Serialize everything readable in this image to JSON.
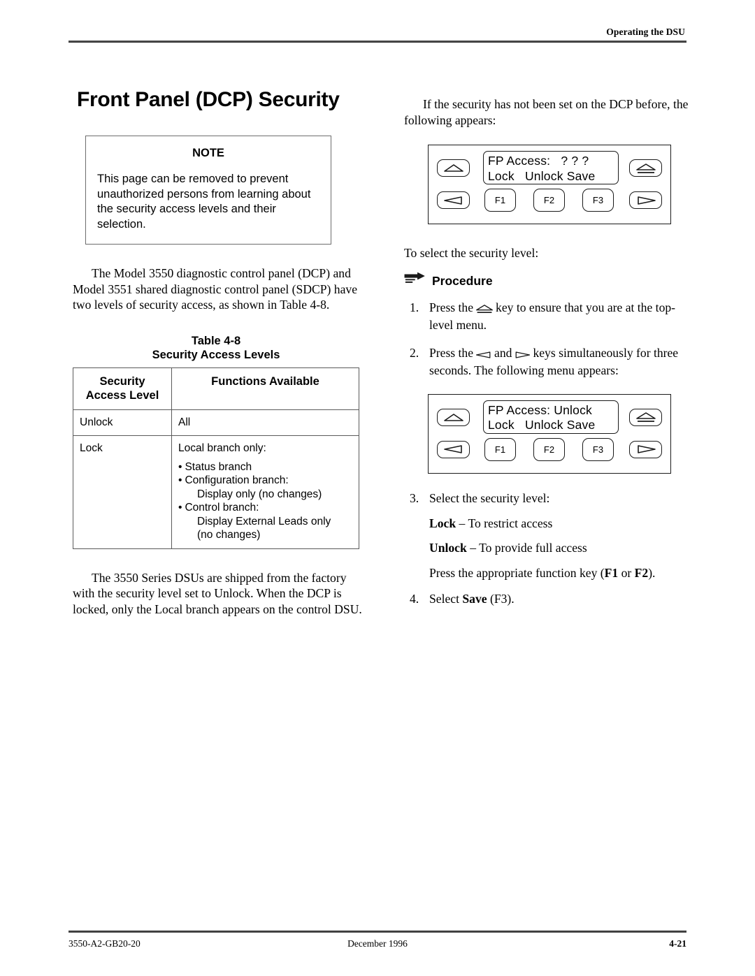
{
  "header": {
    "running_title": "Operating the DSU"
  },
  "left": {
    "headline": "Front Panel (DCP) Security",
    "note": {
      "title": "NOTE",
      "body": "This page can be removed to prevent unauthorized persons from learning about the security access levels and their selection."
    },
    "intro_paragraph": "The Model 3550 diagnostic control panel (DCP) and Model 3551 shared diagnostic control panel (SDCP) have two levels of security access, as shown in Table 4-8.",
    "table": {
      "caption_number": "Table 4-8",
      "caption_title": "Security Access Levels",
      "headers": [
        "Security Access Level",
        "Functions Available"
      ],
      "header_line1": "Security",
      "header_line2": "Access Level",
      "rows": [
        {
          "level": "Unlock",
          "functions_lead": "All",
          "functions_items": []
        },
        {
          "level": "Lock",
          "functions_lead": "Local branch only:",
          "functions_items": [
            {
              "bullet": "•",
              "text": "Status branch",
              "sub": ""
            },
            {
              "bullet": "•",
              "text": "Configuration branch:",
              "sub": "Display only (no changes)"
            },
            {
              "bullet": "•",
              "text": "Control branch:",
              "sub": "Display External Leads only\n(no changes)"
            }
          ]
        }
      ]
    },
    "closing_paragraph": "The 3550 Series DSUs are shipped from the factory with the security level set to Unlock. When the DCP is locked, only the Local branch appears on the control DSU."
  },
  "right": {
    "intro_paragraph": "If the security has not been set on the DCP before, the following appears:",
    "panel_1": {
      "lcd_line_1": "FP Access:   ? ? ?",
      "lcd_line_2": "Lock   Unlock Save",
      "keys": {
        "up": "up-arrow-key",
        "home": "top-level-key",
        "left": "left-arrow-key",
        "right": "right-arrow-key",
        "f1": "F1",
        "f2": "F2",
        "f3": "F3"
      }
    },
    "select_line": "To select the security level:",
    "procedure_heading": "Procedure",
    "procedure_icon": "pointing-hand-icon",
    "steps": [
      {
        "number": "1.",
        "before": "Press the",
        "glyph": "top-level-key",
        "after": "key to ensure that you are at the top-level menu."
      },
      {
        "number": "2.",
        "before": "Press the",
        "glyph_a": "left-arrow-key",
        "middle": "and",
        "glyph_b": "right-arrow-key",
        "after": "keys simultaneously for three seconds. The following menu appears:"
      }
    ],
    "panel_2": {
      "lcd_line_1": "FP Access: Unlock",
      "lcd_line_2": "Lock   Unlock Save",
      "keys": {
        "up": "up-arrow-key",
        "home": "top-level-key",
        "left": "left-arrow-key",
        "right": "right-arrow-key",
        "f1": "F1",
        "f2": "F2",
        "f3": "F3"
      }
    },
    "step3": {
      "number": "3.",
      "text": "Select the security level:",
      "options": [
        {
          "term": "Lock",
          "dash": "–",
          "desc": "To restrict access"
        },
        {
          "term": "Unlock",
          "dash": "–",
          "desc": "To provide full access"
        }
      ],
      "press_prefix": "Press the appropriate function key (",
      "press_key1": "F1",
      "press_or": " or ",
      "press_key2": "F2",
      "press_suffix": ")."
    },
    "step4": {
      "number": "4.",
      "prefix": "Select ",
      "bold": "Save",
      "suffix": " (F3)."
    }
  },
  "footer": {
    "doc_number": "3550-A2-GB20-20",
    "date": "December 1996",
    "page_number": "4-21"
  }
}
